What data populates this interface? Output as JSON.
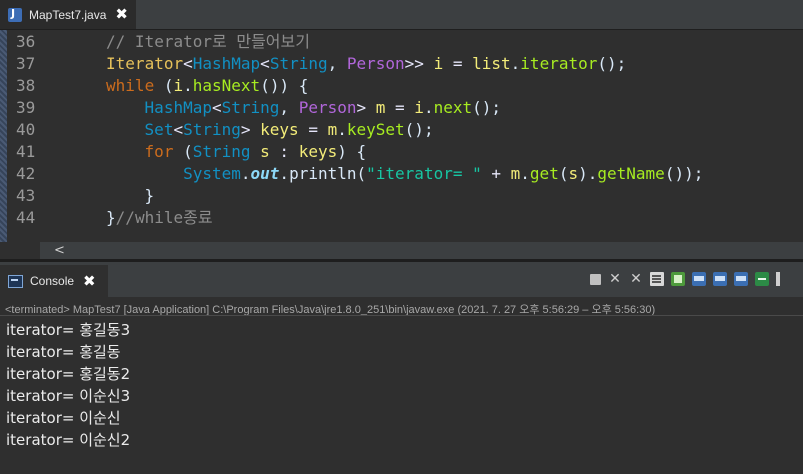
{
  "editor": {
    "tab": {
      "title": "MapTest7.java",
      "close": "✖"
    },
    "scroll_left": "<",
    "lines": [
      {
        "num": "36",
        "indent": 8,
        "tokens": [
          {
            "t": "// Iterator로 만들어보기",
            "c": "cm"
          }
        ]
      },
      {
        "num": "37",
        "indent": 8,
        "tokens": [
          {
            "t": "Iterator",
            "c": "ty2"
          },
          {
            "t": "<",
            "c": "op"
          },
          {
            "t": "HashMap",
            "c": "ty"
          },
          {
            "t": "<",
            "c": "op"
          },
          {
            "t": "String",
            "c": "ty"
          },
          {
            "t": ", ",
            "c": "pl"
          },
          {
            "t": "Person",
            "c": "gn"
          },
          {
            "t": ">> ",
            "c": "op"
          },
          {
            "t": "i",
            "c": "var"
          },
          {
            "t": " = ",
            "c": "op"
          },
          {
            "t": "list",
            "c": "var"
          },
          {
            "t": ".",
            "c": "pl"
          },
          {
            "t": "iterator",
            "c": "mt"
          },
          {
            "t": "();",
            "c": "pl"
          }
        ]
      },
      {
        "num": "38",
        "indent": 8,
        "tokens": [
          {
            "t": "while",
            "c": "kw"
          },
          {
            "t": " (",
            "c": "pl"
          },
          {
            "t": "i",
            "c": "var"
          },
          {
            "t": ".",
            "c": "pl"
          },
          {
            "t": "hasNext",
            "c": "mt"
          },
          {
            "t": "()) {",
            "c": "pl"
          }
        ]
      },
      {
        "num": "39",
        "indent": 12,
        "tokens": [
          {
            "t": "HashMap",
            "c": "ty"
          },
          {
            "t": "<",
            "c": "op"
          },
          {
            "t": "String",
            "c": "ty"
          },
          {
            "t": ", ",
            "c": "pl"
          },
          {
            "t": "Person",
            "c": "gn"
          },
          {
            "t": "> ",
            "c": "op"
          },
          {
            "t": "m",
            "c": "var"
          },
          {
            "t": " = ",
            "c": "op"
          },
          {
            "t": "i",
            "c": "var"
          },
          {
            "t": ".",
            "c": "pl"
          },
          {
            "t": "next",
            "c": "mt"
          },
          {
            "t": "();",
            "c": "pl"
          }
        ]
      },
      {
        "num": "40",
        "indent": 12,
        "tokens": [
          {
            "t": "Set",
            "c": "ty"
          },
          {
            "t": "<",
            "c": "op"
          },
          {
            "t": "String",
            "c": "ty"
          },
          {
            "t": "> ",
            "c": "op"
          },
          {
            "t": "keys",
            "c": "var"
          },
          {
            "t": " = ",
            "c": "op"
          },
          {
            "t": "m",
            "c": "var"
          },
          {
            "t": ".",
            "c": "pl"
          },
          {
            "t": "keySet",
            "c": "mt"
          },
          {
            "t": "();",
            "c": "pl"
          }
        ]
      },
      {
        "num": "41",
        "indent": 12,
        "tokens": [
          {
            "t": "for",
            "c": "kw"
          },
          {
            "t": " (",
            "c": "pl"
          },
          {
            "t": "String",
            "c": "ty"
          },
          {
            "t": " s",
            "c": "var"
          },
          {
            "t": " : ",
            "c": "op"
          },
          {
            "t": "keys",
            "c": "var"
          },
          {
            "t": ") {",
            "c": "pl"
          }
        ]
      },
      {
        "num": "42",
        "indent": 16,
        "tokens": [
          {
            "t": "System",
            "c": "ty"
          },
          {
            "t": ".",
            "c": "pl"
          },
          {
            "t": "out",
            "c": "fd"
          },
          {
            "t": ".",
            "c": "pl"
          },
          {
            "t": "println",
            "c": "pl"
          },
          {
            "t": "(",
            "c": "pl"
          },
          {
            "t": "\"iterator= \"",
            "c": "st"
          },
          {
            "t": " + ",
            "c": "op"
          },
          {
            "t": "m",
            "c": "var"
          },
          {
            "t": ".",
            "c": "pl"
          },
          {
            "t": "get",
            "c": "mt"
          },
          {
            "t": "(",
            "c": "pl"
          },
          {
            "t": "s",
            "c": "var"
          },
          {
            "t": ").",
            "c": "pl"
          },
          {
            "t": "getName",
            "c": "mt"
          },
          {
            "t": "());",
            "c": "pl"
          }
        ]
      },
      {
        "num": "43",
        "indent": 12,
        "tokens": [
          {
            "t": "}",
            "c": "pl"
          }
        ]
      },
      {
        "num": "44",
        "indent": 8,
        "tokens": [
          {
            "t": "}",
            "c": "pl"
          },
          {
            "t": "//while종료",
            "c": "cm"
          }
        ]
      }
    ]
  },
  "console": {
    "tab": {
      "title": "Console",
      "close": "✖"
    },
    "toolbar": [
      {
        "name": "terminate-icon",
        "kind": "stop"
      },
      {
        "name": "remove-launch-icon",
        "kind": "remove"
      },
      {
        "name": "remove-all-terminated-icon",
        "kind": "removeall"
      },
      {
        "name": "clear-console-icon",
        "kind": "doc"
      },
      {
        "name": "scroll-lock-icon",
        "kind": "green"
      },
      {
        "name": "word-wrap-icon",
        "kind": "blue"
      },
      {
        "name": "show-console-on-output-icon",
        "kind": "blue"
      },
      {
        "name": "show-console-on-error-icon",
        "kind": "blue"
      },
      {
        "name": "pin-console-icon",
        "kind": "pin"
      },
      {
        "name": "more-icon",
        "kind": "more"
      }
    ],
    "status": "<terminated> MapTest7 [Java Application] C:\\Program Files\\Java\\jre1.8.0_251\\bin\\javaw.exe  (2021. 7. 27 오후 5:56:29 – 오후 5:56:30)",
    "output": [
      "iterator= 홍길동3",
      "iterator= 홍길동",
      "iterator= 홍길동2",
      "iterator= 이순신3",
      "iterator= 이순신",
      "iterator= 이순신2"
    ]
  }
}
